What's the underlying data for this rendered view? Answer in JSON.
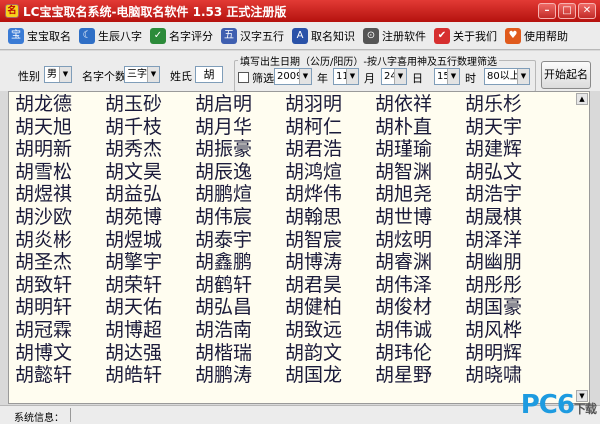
{
  "window": {
    "title": "LC宝宝取名系统-电脑取名软件 1.53 正式注册版",
    "app_icon_glyph": "名",
    "controls": [
      "minimize",
      "maximize",
      "close"
    ]
  },
  "toolbar": {
    "items": [
      {
        "label": "宝宝取名",
        "icon": "baby-icon",
        "color": "#3a7bd5",
        "glyph": "宝"
      },
      {
        "label": "生辰八字",
        "icon": "moon-icon",
        "color": "#2f6fc6",
        "glyph": "☾"
      },
      {
        "label": "名字评分",
        "icon": "score-icon",
        "color": "#2c8b3a",
        "glyph": "✓"
      },
      {
        "label": "汉字五行",
        "icon": "elements-icon",
        "color": "#3f5fb0",
        "glyph": "五"
      },
      {
        "label": "取名知识",
        "icon": "book-icon",
        "color": "#2a52a8",
        "glyph": "A"
      },
      {
        "label": "注册软件",
        "icon": "register-icon",
        "color": "#555555",
        "glyph": "⊙"
      },
      {
        "label": "关于我们",
        "icon": "about-icon",
        "color": "#d62f2f",
        "glyph": "✔"
      },
      {
        "label": "使用帮助",
        "icon": "help-icon",
        "color": "#e05a1c",
        "glyph": "♥"
      }
    ]
  },
  "filters": {
    "gender_label": "性别",
    "gender_value": "男",
    "count_label": "名字个数",
    "count_value": "三字",
    "surname_label": "姓氏",
    "surname_value": "胡",
    "birth_group_title": "填写出生日期（公历/阳历）-按八字喜用神及五行数理筛选",
    "filter_checkbox_label": "筛选",
    "year_value": "2009",
    "year_label": "年",
    "month_value": "11",
    "month_label": "月",
    "day_value": "24",
    "day_label": "日",
    "hour_value": "15",
    "hour_label": "时",
    "score_value": "80以上",
    "start_button": "开始起名"
  },
  "names": [
    "胡龙德",
    "胡玉砂",
    "胡启明",
    "胡羽明",
    "胡依祥",
    "胡乐杉",
    "胡天旭",
    "胡千枝",
    "胡月华",
    "胡柯仁",
    "胡朴直",
    "胡天宇",
    "胡明新",
    "胡秀杰",
    "胡振豪",
    "胡君浩",
    "胡瑾瑜",
    "胡建辉",
    "胡雪松",
    "胡文昊",
    "胡辰逸",
    "胡鸿煊",
    "胡智渊",
    "胡弘文",
    "胡煜祺",
    "胡益弘",
    "胡鹏煊",
    "胡烨伟",
    "胡旭尧",
    "胡浩宇",
    "胡沙欧",
    "胡苑博",
    "胡伟宸",
    "胡翰思",
    "胡世博",
    "胡晟棋",
    "胡炎彬",
    "胡煜城",
    "胡泰宇",
    "胡智宸",
    "胡炫明",
    "胡泽洋",
    "胡圣杰",
    "胡擎宇",
    "胡鑫鹏",
    "胡博涛",
    "胡睿渊",
    "胡幽朋",
    "胡致轩",
    "胡荣轩",
    "胡鹤轩",
    "胡君昊",
    "胡伟泽",
    "胡彤彤",
    "胡明轩",
    "胡天佑",
    "胡弘昌",
    "胡健柏",
    "胡俊材",
    "胡国豪",
    "胡冠霖",
    "胡博超",
    "胡浩南",
    "胡致远",
    "胡伟诚",
    "胡风桦",
    "胡博文",
    "胡达强",
    "胡楷瑞",
    "胡韵文",
    "胡玮伦",
    "胡明辉",
    "胡懿轩",
    "胡皓轩",
    "胡鹏涛",
    "胡国龙",
    "胡星野",
    "胡晓啸"
  ],
  "status": {
    "label": "系统信息："
  },
  "watermark": {
    "text": "PC6",
    "sub": "下载"
  }
}
